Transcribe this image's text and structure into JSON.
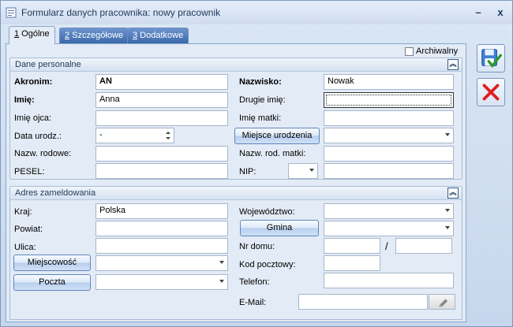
{
  "window": {
    "title": "Formularz danych pracownika: nowy pracownik",
    "min_glyph": "–",
    "close_glyph": "x"
  },
  "tabs": [
    {
      "num": "1",
      "label": " Ogólne"
    },
    {
      "num": "2",
      "label": " Szczegółowe"
    },
    {
      "num": "3",
      "label": " Dodatkowe"
    }
  ],
  "archiwalny_label": "Archiwalny",
  "personal": {
    "header": "Dane personalne",
    "akronim_label": "Akronim:",
    "akronim_value": "AN",
    "nazwisko_label": "Nazwisko:",
    "nazwisko_value": "Nowak",
    "imie_label": "Imię:",
    "imie_value": "Anna",
    "drugie_imie_label": "Drugie imię:",
    "drugie_imie_value": "",
    "imie_ojca_label": "Imię ojca:",
    "imie_ojca_value": "",
    "imie_matki_label": "Imię matki:",
    "imie_matki_value": "",
    "data_urodz_label": "Data urodz.:",
    "data_urodz_value": "-",
    "miejsce_urodzenia_button": "Miejsce urodzenia",
    "miejsce_urodzenia_value": "",
    "nazw_rodowe_label": "Nazw. rodowe:",
    "nazw_rodowe_value": "",
    "nazw_rod_matki_label": "Nazw. rod. matki:",
    "nazw_rod_matki_value": "",
    "pesel_label": "PESEL:",
    "pesel_value": "",
    "nip_label": "NIP:",
    "nip_value": ""
  },
  "address": {
    "header": "Adres zameldowania",
    "kraj_label": "Kraj:",
    "kraj_value": "Polska",
    "wojewodztwo_label": "Województwo:",
    "wojewodztwo_value": "",
    "powiat_label": "Powiat:",
    "powiat_value": "",
    "gmina_button": "Gmina",
    "gmina_value": "",
    "ulica_label": "Ulica:",
    "ulica_value": "",
    "nr_domu_label": "Nr domu:",
    "nr_domu_value": "",
    "nr_sep": "/",
    "nr_lokalu_value": "",
    "miejscowosc_button": "Miejscowość",
    "miejscowosc_value": "",
    "kod_pocztowy_label": "Kod pocztowy:",
    "kod_pocztowy_value": "",
    "poczta_button": "Poczta",
    "poczta_value": "",
    "telefon_label": "Telefon:",
    "telefon_value": "",
    "email_label": "E-Mail:",
    "email_value": ""
  },
  "colors": {
    "accept": "#2f7fd0",
    "cancel": "#e02020"
  }
}
